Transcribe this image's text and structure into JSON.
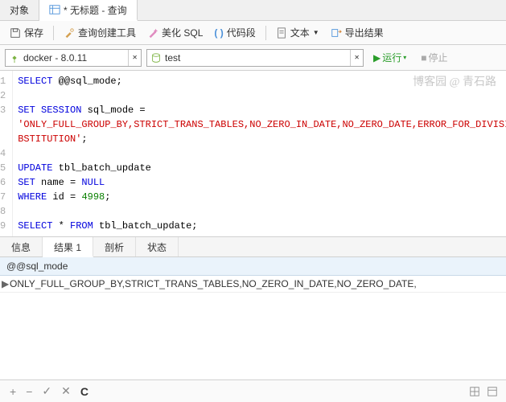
{
  "topTabs": {
    "objects": "对象",
    "query": "* 无标题 - 查询"
  },
  "toolbar": {
    "save": "保存",
    "queryBuilder": "查询创建工具",
    "beautify": "美化 SQL",
    "snippet": "代码段",
    "text": "文本",
    "export": "导出结果"
  },
  "conn": {
    "connection": "docker - 8.0.11",
    "database": "test",
    "run": "运行",
    "stop": "停止"
  },
  "watermark": "博客园 @ 青石路",
  "code": {
    "lines": [
      {
        "n": "1",
        "seg": [
          {
            "c": "kw",
            "t": "SELECT"
          },
          {
            "c": "id",
            "t": " @@sql_mode;"
          }
        ]
      },
      {
        "n": "2",
        "seg": []
      },
      {
        "n": "3",
        "seg": [
          {
            "c": "kw",
            "t": "SET SESSION"
          },
          {
            "c": "id",
            "t": " sql_mode = "
          }
        ]
      },
      {
        "n": "",
        "seg": [
          {
            "c": "str",
            "t": "'ONLY_FULL_GROUP_BY,STRICT_TRANS_TABLES,NO_ZERO_IN_DATE,NO_ZERO_DATE,ERROR_FOR_DIVISION_BY_ZERO,NO_ENGINE_SU"
          }
        ]
      },
      {
        "n": "",
        "seg": [
          {
            "c": "str",
            "t": "BSTITUTION'"
          },
          {
            "c": "id",
            "t": ";"
          }
        ]
      },
      {
        "n": "4",
        "seg": []
      },
      {
        "n": "5",
        "seg": [
          {
            "c": "kw",
            "t": "UPDATE"
          },
          {
            "c": "id",
            "t": " tbl_batch_update"
          }
        ]
      },
      {
        "n": "6",
        "seg": [
          {
            "c": "kw",
            "t": "SET"
          },
          {
            "c": "id",
            "t": " name = "
          },
          {
            "c": "kw",
            "t": "NULL"
          }
        ]
      },
      {
        "n": "7",
        "seg": [
          {
            "c": "kw",
            "t": "WHERE"
          },
          {
            "c": "id",
            "t": " id = "
          },
          {
            "c": "num",
            "t": "4998"
          },
          {
            "c": "id",
            "t": ";"
          }
        ]
      },
      {
        "n": "8",
        "seg": []
      },
      {
        "n": "9",
        "seg": [
          {
            "c": "kw",
            "t": "SELECT"
          },
          {
            "c": "id",
            "t": " * "
          },
          {
            "c": "kw",
            "t": "FROM"
          },
          {
            "c": "id",
            "t": " tbl_batch_update;"
          }
        ]
      }
    ]
  },
  "resultTabs": {
    "info": "信息",
    "result": "结果 1",
    "profile": "剖析",
    "status": "状态"
  },
  "grid": {
    "header": "@@sql_mode",
    "rows": [
      "ONLY_FULL_GROUP_BY,STRICT_TRANS_TABLES,NO_ZERO_IN_DATE,NO_ZERO_DATE,"
    ]
  },
  "footer": {
    "add": "+",
    "remove": "−",
    "apply": "✓",
    "cancel": "✕",
    "refresh": "C"
  }
}
